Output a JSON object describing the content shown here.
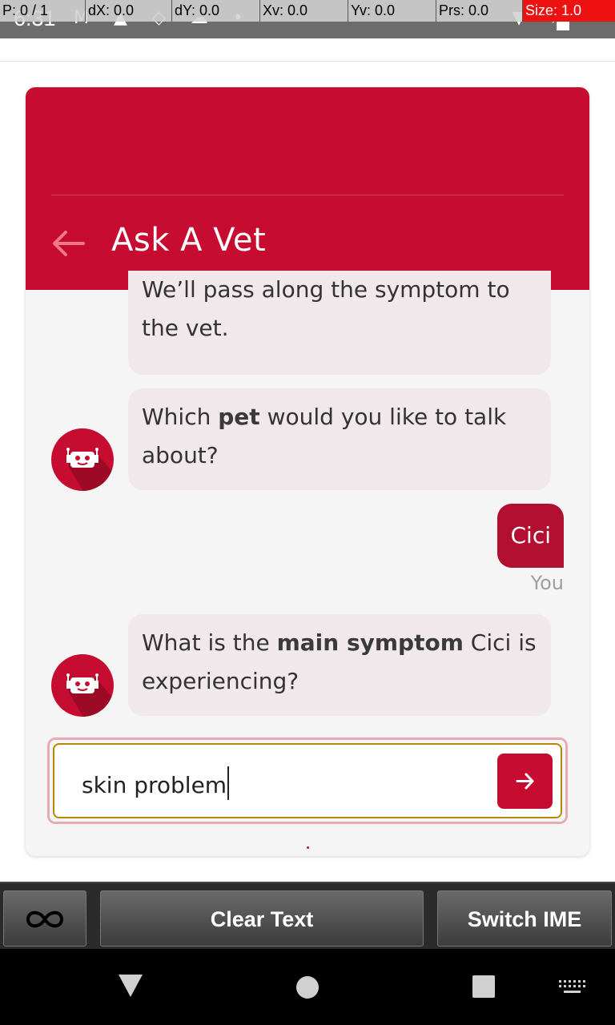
{
  "status_bar": {
    "time": "6:31",
    "left_icons": "M ▲ ◇ ☁ •",
    "right_icons": "▼ ✈"
  },
  "pointer_overlay": {
    "p": "P: 0 / 1",
    "dx": "dX: 0.0",
    "dy": "dY: 0.0",
    "xv": "Xv: 0.0",
    "yv": "Yv: 0.0",
    "prs": "Prs: 0.0",
    "size": "Size: 1.0"
  },
  "header": {
    "title": "Ask A Vet",
    "back_icon": "arrow-left-icon"
  },
  "messages": {
    "bot_1_text": "We’ll pass along the symptom to the vet.",
    "bot_2_pre": "Which ",
    "bot_2_bold": "pet",
    "bot_2_post": " would you like to talk about?",
    "user_1": "Cici",
    "user_label": "You",
    "bot_3_pre": "What is the ",
    "bot_3_bold": "main symptom",
    "bot_3_post": " Cici is experiencing?"
  },
  "input": {
    "value": "skin problem",
    "send_icon": "arrow-right-icon"
  },
  "ime_toolbar": {
    "loop_icon": "infinity-icon",
    "clear_label": "Clear Text",
    "switch_label": "Switch IME"
  },
  "colors": {
    "brand": "#c60c30",
    "user_bubble": "#b30f30",
    "bot_bubble": "#f1e8eb"
  }
}
